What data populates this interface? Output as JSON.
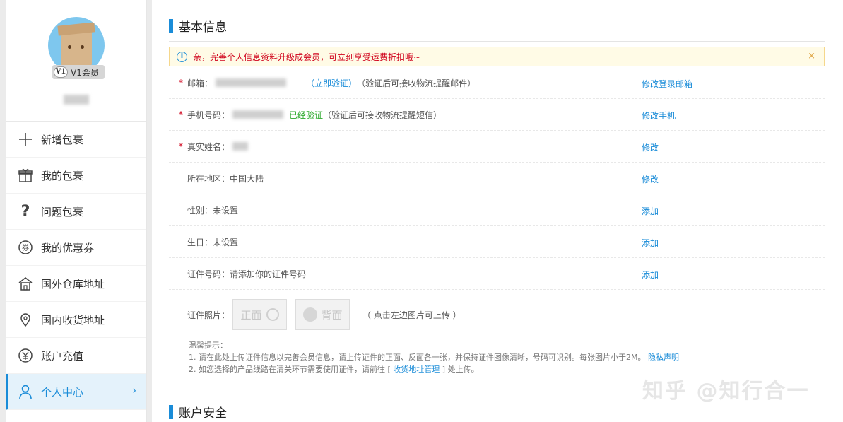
{
  "sidebar": {
    "vip_badge": "V1会员",
    "vip_icon": "V1",
    "items": [
      {
        "icon": "plus-icon",
        "label": "新增包裹"
      },
      {
        "icon": "gift-box-icon",
        "label": "我的包裹"
      },
      {
        "icon": "question-icon",
        "label": "问题包裹"
      },
      {
        "icon": "coupon-icon",
        "label": "我的优惠券"
      },
      {
        "icon": "warehouse-icon",
        "label": "国外仓库地址"
      },
      {
        "icon": "location-pin-icon",
        "label": "国内收货地址"
      },
      {
        "icon": "yen-icon",
        "label": "账户充值"
      },
      {
        "icon": "user-icon",
        "label": "个人中心",
        "active": true
      }
    ]
  },
  "main": {
    "section1_title": "基本信息",
    "notice": "亲，完善个人信息资料升级成会员，可立刻享受运费折扣哦~",
    "rows": {
      "email": {
        "label": "邮箱：",
        "verify": "立即验证",
        "hint": "（验证后可接收物流提醒邮件）",
        "action": "修改登录邮箱"
      },
      "phone": {
        "label": "手机号码：",
        "verified": "已经验证",
        "hint": "（验证后可接收物流提醒短信）",
        "action": "修改手机"
      },
      "realname": {
        "label": "真实姓名：",
        "action": "修改"
      },
      "region": {
        "label": "所在地区：中国大陆",
        "action": "修改"
      },
      "gender": {
        "label": "性别：未设置",
        "action": "添加"
      },
      "birthday": {
        "label": "生日：未设置",
        "action": "添加"
      },
      "idnumber": {
        "label": "证件号码：请添加你的证件号码",
        "action": "添加"
      }
    },
    "photo": {
      "label": "证件照片：",
      "front": "正面",
      "back": "背面",
      "hint": "（ 点击左边图片可上传 ）"
    },
    "tips": {
      "title": "温馨提示：",
      "line1": "1. 请在此处上传证件信息以完善会员信息，请上传证件的正面、反面各一张，并保持证件图像清晰，号码可识别。每张图片小于2M。",
      "line1_link": "隐私声明",
      "line2_prefix": "2. 如您选择的产品线路在清关环节需要使用证件，请前往 [ ",
      "line2_link": "收货地址管理",
      "line2_suffix": " ] 处上传。"
    },
    "section2_title": "账户安全",
    "watermark": "知乎 @知行合一"
  },
  "colors": {
    "accent": "#1a8cd8",
    "required": "#d0021b",
    "verified": "#2aa82a"
  }
}
